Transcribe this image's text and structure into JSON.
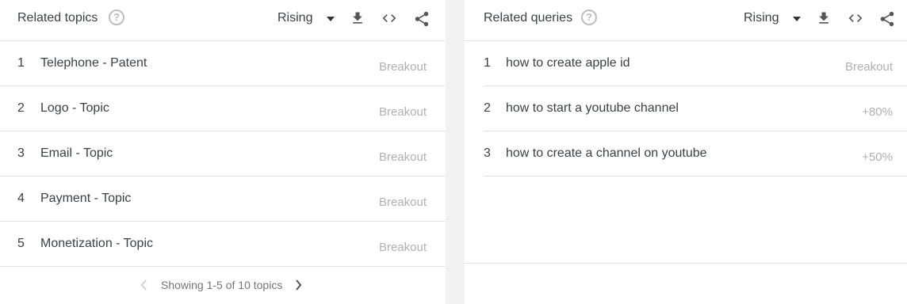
{
  "topics": {
    "title": "Related topics",
    "dropdown": "Rising",
    "rows": [
      {
        "rank": "1",
        "label": "Telephone - Patent",
        "value": "Breakout"
      },
      {
        "rank": "2",
        "label": "Logo - Topic",
        "value": "Breakout"
      },
      {
        "rank": "3",
        "label": "Email - Topic",
        "value": "Breakout"
      },
      {
        "rank": "4",
        "label": "Payment - Topic",
        "value": "Breakout"
      },
      {
        "rank": "5",
        "label": "Monetization - Topic",
        "value": "Breakout"
      }
    ],
    "pager_text": "Showing 1-5 of 10 topics"
  },
  "queries": {
    "title": "Related queries",
    "dropdown": "Rising",
    "rows": [
      {
        "rank": "1",
        "label": "how to create apple id",
        "value": "Breakout"
      },
      {
        "rank": "2",
        "label": "how to start a youtube channel",
        "value": "+80%"
      },
      {
        "rank": "3",
        "label": "how to create a channel on youtube",
        "value": "+50%"
      }
    ]
  },
  "icons": {
    "help": "help-icon",
    "download": "download-icon",
    "embed": "embed-code-icon",
    "share": "share-icon",
    "prev": "chevron-left-icon",
    "next": "chevron-right-icon"
  },
  "colors": {
    "text": "#3c4043",
    "muted": "#b0b0b0",
    "divider": "#e0e0e0",
    "background": "#f1f1f1"
  }
}
